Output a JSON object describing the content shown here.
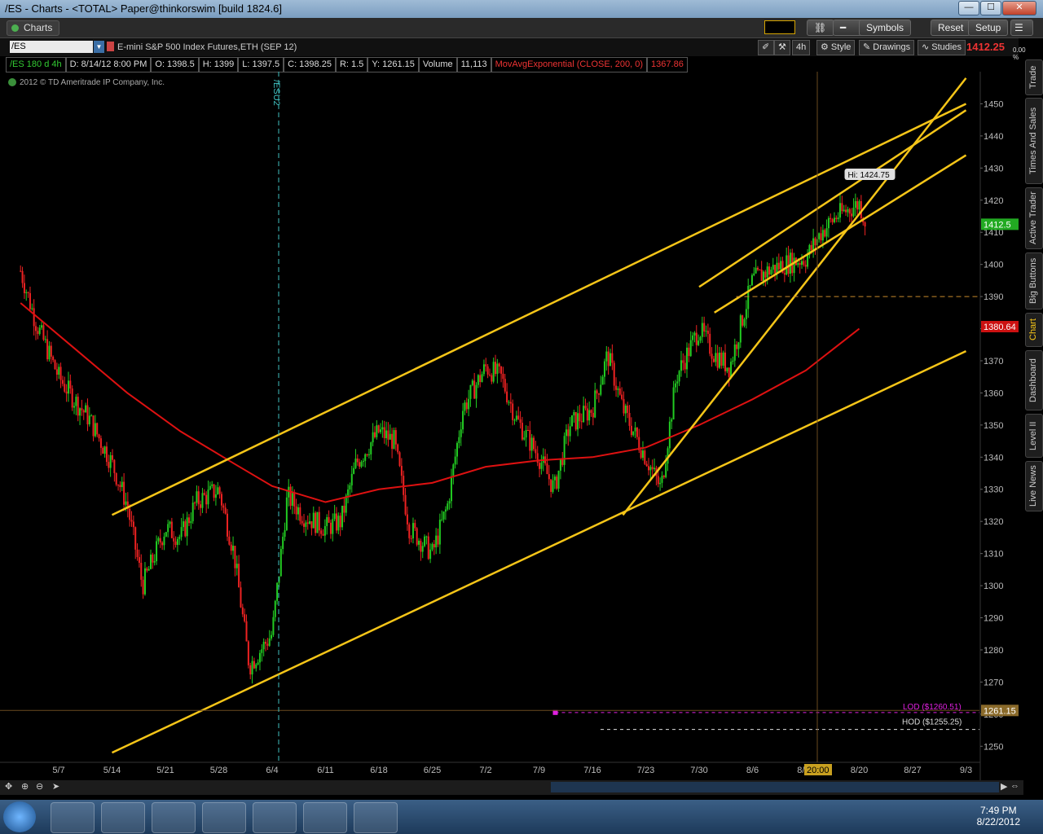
{
  "window": {
    "title": "/ES - Charts - <TOTAL> Paper@thinkorswim [build 1824.6]",
    "min": "—",
    "max": "☐",
    "close": "✕"
  },
  "toolbar": {
    "tab": "Charts",
    "symbols_label": "Symbols",
    "reset_label": "Reset",
    "setup_label": "Setup"
  },
  "symbol_bar": {
    "symbol": "/ES",
    "description": "E-mini S&P 500 Index Futures,ETH (SEP 12)",
    "aggregation": "4h",
    "style_label": "Style",
    "drawings_label": "Drawings",
    "studies_label": "Studies",
    "last_price": "1412.25",
    "percent_change": "0.00 %"
  },
  "info_bar": [
    "/ES 180 d 4h",
    "D: 8/14/12 8:00 PM",
    "O: 1398.5",
    "H: 1399",
    "L: 1397.5",
    "C: 1398.25",
    "R: 1.5",
    "Y: 1261.15",
    "Volume",
    "11,113"
  ],
  "study_label": "MovAvgExponential (CLOSE, 200, 0)",
  "study_value": "1367.86",
  "copyright": "2012 © TD Ameritrade IP Company, Inc.",
  "contract_roll": "/ESU2",
  "annotations": {
    "hi": "Hi: 1424.75",
    "lod": "LOD ($1260.51)",
    "hod": "HOD ($1255.25)",
    "time_marker": "20:00"
  },
  "price_tags": {
    "last": "1412.5",
    "ema": "1380.64",
    "yclose": "1261.15"
  },
  "colors": {
    "up": "#22cc22",
    "down": "#ee2222",
    "ema": "#dd1111",
    "trendline": "#f5c518",
    "grid": "#1a1a1a"
  },
  "right_tabs": [
    "Trade",
    "Times And Sales",
    "Active Trader",
    "Big Buttons",
    "Chart",
    "Dashboard",
    "Level II",
    "Live News"
  ],
  "taskbar": {
    "time": "7:49 PM",
    "date": "8/22/2012"
  },
  "chart_data": {
    "type": "candlestick",
    "symbol": "/ES",
    "aggregation": "4h",
    "ylim": [
      1245,
      1460
    ],
    "y_ticks": [
      1250,
      1260,
      1270,
      1280,
      1290,
      1300,
      1310,
      1320,
      1330,
      1340,
      1350,
      1360,
      1370,
      1380,
      1390,
      1400,
      1410,
      1420,
      1430,
      1440,
      1450
    ],
    "x_ticks": [
      "5/7",
      "5/14",
      "5/21",
      "5/28",
      "6/4",
      "6/11",
      "6/18",
      "6/25",
      "7/2",
      "7/9",
      "7/16",
      "7/23",
      "7/30",
      "8/6",
      "8/13",
      "8/20",
      "8/27",
      "9/3"
    ],
    "close_path": [
      [
        "5/2",
        1398
      ],
      [
        "5/4",
        1382
      ],
      [
        "5/7",
        1365
      ],
      [
        "5/9",
        1358
      ],
      [
        "5/11",
        1352
      ],
      [
        "5/14",
        1338
      ],
      [
        "5/16",
        1325
      ],
      [
        "5/18",
        1300
      ],
      [
        "5/21",
        1318
      ],
      [
        "5/23",
        1315
      ],
      [
        "5/25",
        1326
      ],
      [
        "5/28",
        1330
      ],
      [
        "5/30",
        1310
      ],
      [
        "6/1",
        1275
      ],
      [
        "6/4",
        1285
      ],
      [
        "6/6",
        1328
      ],
      [
        "6/8",
        1322
      ],
      [
        "6/11",
        1318
      ],
      [
        "6/13",
        1320
      ],
      [
        "6/15",
        1338
      ],
      [
        "6/18",
        1348
      ],
      [
        "6/20",
        1345
      ],
      [
        "6/22",
        1318
      ],
      [
        "6/25",
        1310
      ],
      [
        "6/27",
        1325
      ],
      [
        "6/29",
        1355
      ],
      [
        "7/2",
        1368
      ],
      [
        "7/4",
        1365
      ],
      [
        "7/6",
        1352
      ],
      [
        "7/9",
        1340
      ],
      [
        "7/11",
        1330
      ],
      [
        "7/13",
        1350
      ],
      [
        "7/16",
        1355
      ],
      [
        "7/18",
        1372
      ],
      [
        "7/20",
        1355
      ],
      [
        "7/23",
        1340
      ],
      [
        "7/25",
        1330
      ],
      [
        "7/27",
        1365
      ],
      [
        "7/30",
        1380
      ],
      [
        "8/1",
        1372
      ],
      [
        "8/3",
        1368
      ],
      [
        "8/6",
        1395
      ],
      [
        "8/8",
        1398
      ],
      [
        "8/10",
        1400
      ],
      [
        "8/13",
        1402
      ],
      [
        "8/15",
        1410
      ],
      [
        "8/17",
        1415
      ],
      [
        "8/20",
        1419
      ],
      [
        "8/21",
        1412
      ]
    ],
    "ema200": [
      [
        "5/2",
        1388
      ],
      [
        "5/9",
        1374
      ],
      [
        "5/16",
        1360
      ],
      [
        "5/23",
        1348
      ],
      [
        "5/30",
        1338
      ],
      [
        "6/4",
        1331
      ],
      [
        "6/11",
        1326
      ],
      [
        "6/18",
        1330
      ],
      [
        "6/25",
        1332
      ],
      [
        "7/2",
        1337
      ],
      [
        "7/9",
        1339
      ],
      [
        "7/16",
        1340
      ],
      [
        "7/23",
        1343
      ],
      [
        "7/30",
        1350
      ],
      [
        "8/6",
        1358
      ],
      [
        "8/13",
        1367
      ],
      [
        "8/20",
        1380
      ]
    ],
    "trendlines": [
      {
        "from": [
          "5/14",
          1322
        ],
        "to": [
          "9/3",
          1450
        ]
      },
      {
        "from": [
          "5/14",
          1248
        ],
        "to": [
          "9/3",
          1373
        ]
      },
      {
        "from": [
          "7/30",
          1393
        ],
        "to": [
          "9/3",
          1448
        ]
      },
      {
        "from": [
          "8/1",
          1385
        ],
        "to": [
          "9/3",
          1434
        ]
      },
      {
        "from": [
          "7/20",
          1322
        ],
        "to": [
          "9/3",
          1458
        ]
      }
    ],
    "horizontal_levels": [
      1390,
      1260.51,
      1255.25
    ]
  }
}
